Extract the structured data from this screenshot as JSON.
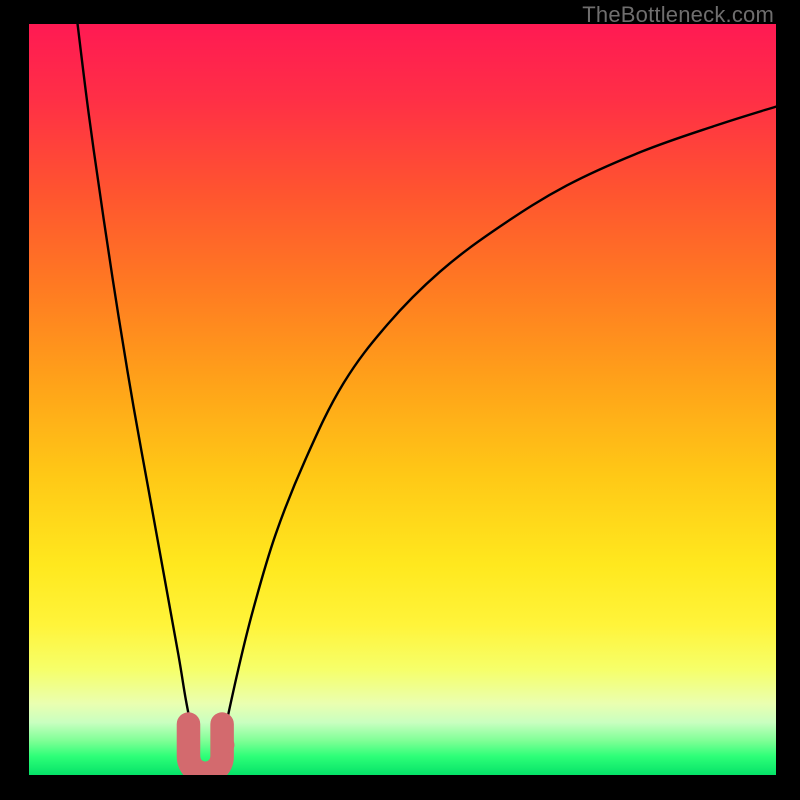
{
  "watermark": "TheBottleneck.com",
  "colors": {
    "black": "#000000",
    "curve": "#000000",
    "marker": "#d36a6e",
    "gradient_stops": [
      {
        "offset": 0.0,
        "color": "#ff1a53"
      },
      {
        "offset": 0.1,
        "color": "#ff2f46"
      },
      {
        "offset": 0.22,
        "color": "#ff5330"
      },
      {
        "offset": 0.35,
        "color": "#ff7a22"
      },
      {
        "offset": 0.48,
        "color": "#ffa319"
      },
      {
        "offset": 0.6,
        "color": "#ffc816"
      },
      {
        "offset": 0.72,
        "color": "#ffe81e"
      },
      {
        "offset": 0.8,
        "color": "#fff43a"
      },
      {
        "offset": 0.86,
        "color": "#f6ff6a"
      },
      {
        "offset": 0.905,
        "color": "#eaffb0"
      },
      {
        "offset": 0.93,
        "color": "#c9ffc0"
      },
      {
        "offset": 0.955,
        "color": "#7dff95"
      },
      {
        "offset": 0.975,
        "color": "#2eff78"
      },
      {
        "offset": 1.0,
        "color": "#05e268"
      }
    ]
  },
  "chart_data": {
    "type": "line",
    "title": "",
    "xlabel": "",
    "ylabel": "",
    "xlim": [
      0,
      100
    ],
    "ylim": [
      0,
      100
    ],
    "grid": false,
    "legend": false,
    "series": [
      {
        "name": "left-branch",
        "x": [
          6.5,
          8,
          10,
          12,
          14,
          16,
          18,
          20,
          21,
          22,
          22.8
        ],
        "y": [
          100,
          88,
          74,
          61,
          49,
          38,
          27,
          16,
          10,
          5,
          1.5
        ]
      },
      {
        "name": "right-branch",
        "x": [
          25.2,
          26,
          28,
          30,
          33,
          37,
          42,
          48,
          55,
          63,
          72,
          82,
          92,
          100
        ],
        "y": [
          1.5,
          5,
          14,
          22,
          32,
          42,
          52,
          60,
          67,
          73,
          78.5,
          83,
          86.5,
          89
        ]
      }
    ],
    "markers": [
      {
        "name": "vertex-blob",
        "shape": "U",
        "x_center": 23.6,
        "y_center": 3.5,
        "size": 3.0
      },
      {
        "name": "side-dot",
        "shape": "dot",
        "x": 26.4,
        "y": 4.0,
        "r": 1.1
      }
    ]
  }
}
